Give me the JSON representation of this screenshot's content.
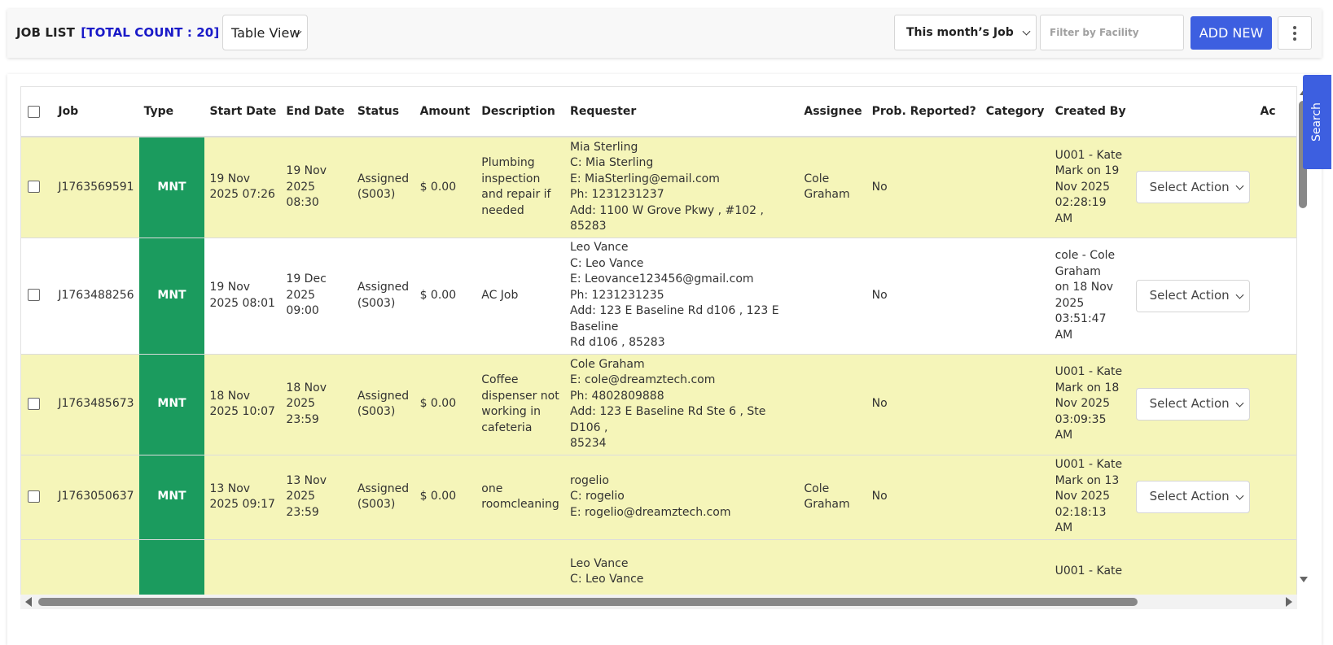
{
  "header": {
    "title": "JOB LIST",
    "total_count": "[TOTAL COUNT : 20]",
    "view_select": "Table View",
    "month_filter": "This month’s Job",
    "facility_placeholder": "Filter by Facility",
    "add_new": "ADD NEW"
  },
  "search_tab": "Search",
  "table": {
    "columns": [
      "Job",
      "Type",
      "Start Date",
      "End Date",
      "Status",
      "Amount",
      "Description",
      "Requester",
      "Assignee",
      "Prob. Reported?",
      "Category",
      "Created By",
      "",
      "Ac"
    ],
    "action_placeholder": "Select Action",
    "rows": [
      {
        "job": "J1763569591",
        "type": "MNT",
        "start": [
          "19 Nov",
          "2025 07:26"
        ],
        "end": [
          "19 Nov",
          "2025 08:30"
        ],
        "status": [
          "Assigned",
          "(S003)"
        ],
        "amount": "$ 0.00",
        "description": [
          "Plumbing",
          "inspection",
          "and repair if",
          "needed"
        ],
        "requester": [
          "Mia Sterling",
          "C: Mia Sterling",
          "E: MiaSterling@email.com",
          "Ph: 1231231237",
          "Add: 1100 W Grove Pkwy , #102 , 85283"
        ],
        "assignee": [
          "Cole",
          "Graham"
        ],
        "reported": "No",
        "category": "",
        "created": [
          "U001 - Kate",
          "Mark on 19",
          "Nov 2025",
          "02:28:19 AM"
        ],
        "color": "yellow"
      },
      {
        "job": "J1763488256",
        "type": "MNT",
        "start": [
          "19 Nov",
          "2025 08:01"
        ],
        "end": [
          "19 Dec",
          "2025 09:00"
        ],
        "status": [
          "Assigned",
          "(S003)"
        ],
        "amount": "$ 0.00",
        "description": [
          "AC Job"
        ],
        "requester": [
          "Leo Vance",
          "C: Leo Vance",
          "E: Leovance123456@gmail.com",
          "Ph: 1231231235",
          "Add: 123 E Baseline Rd d106 , 123 E Baseline",
          "Rd d106 , 85283"
        ],
        "assignee": [],
        "reported": "No",
        "category": "",
        "created": [
          "cole - Cole",
          "Graham",
          "on 18 Nov",
          "2025",
          "03:51:47 AM"
        ],
        "color": "white"
      },
      {
        "job": "J1763485673",
        "type": "MNT",
        "start": [
          "18 Nov",
          "2025 10:07"
        ],
        "end": [
          "18 Nov",
          "2025 23:59"
        ],
        "status": [
          "Assigned",
          "(S003)"
        ],
        "amount": "$ 0.00",
        "description": [
          "Coffee",
          "dispenser not",
          "working in",
          "cafeteria"
        ],
        "requester": [
          "Cole Graham",
          "E: cole@dreamztech.com",
          "Ph: 4802809888",
          "Add: 123 E Baseline Rd Ste 6 , Ste D106 ,",
          "85234"
        ],
        "assignee": [],
        "reported": "No",
        "category": "",
        "created": [
          "U001 - Kate",
          "Mark on 18",
          "Nov 2025",
          "03:09:35",
          "AM"
        ],
        "color": "yellow"
      },
      {
        "job": "J1763050637",
        "type": "MNT",
        "start": [
          "13 Nov",
          "2025 09:17"
        ],
        "end": [
          "13 Nov",
          "2025 23:59"
        ],
        "status": [
          "Assigned",
          "(S003)"
        ],
        "amount": "$ 0.00",
        "description": [
          "one",
          "roomcleaning"
        ],
        "requester": [
          "rogelio",
          "C: rogelio",
          "E: rogelio@dreamztech.com"
        ],
        "assignee": [
          "Cole",
          "Graham"
        ],
        "reported": "No",
        "category": "",
        "created": [
          "U001 - Kate",
          "Mark on 13",
          "Nov 2025",
          "02:18:13 AM"
        ],
        "color": "yellow"
      },
      {
        "job": "",
        "type": "",
        "start": [],
        "end": [],
        "status": [],
        "amount": "",
        "description": [],
        "requester": [
          "Leo Vance",
          "C: Leo Vance"
        ],
        "assignee": [],
        "reported": "",
        "category": "",
        "created": [
          "U001 - Kate"
        ],
        "color": "yellow"
      }
    ]
  }
}
